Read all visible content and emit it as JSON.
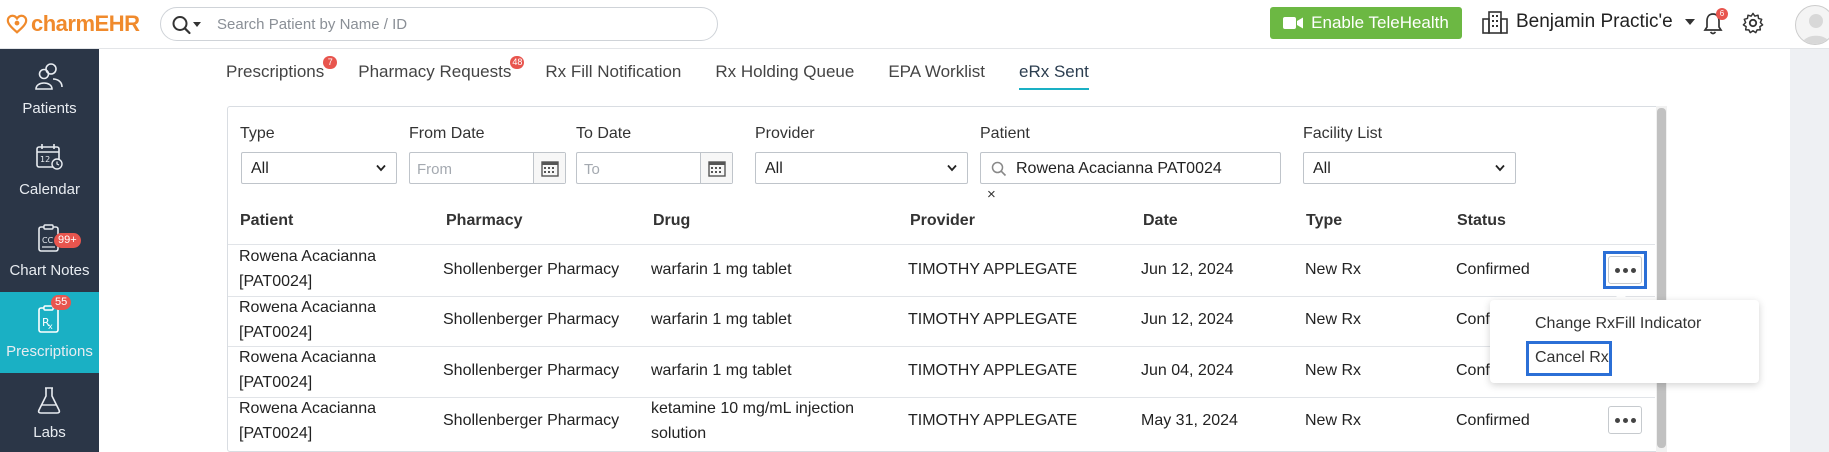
{
  "app": {
    "logo_left": "charm",
    "logo_right": "EHR"
  },
  "header": {
    "search_placeholder": "Search Patient by Name / ID",
    "telehealth_label": "Enable TeleHealth",
    "practice_name": "Benjamin Practic'e",
    "notification_count": "6"
  },
  "sidebar": {
    "items": [
      {
        "label": "Patients",
        "badge": "",
        "icon": "patients-icon"
      },
      {
        "label": "Calendar",
        "badge": "",
        "icon": "calendar-icon"
      },
      {
        "label": "Chart Notes",
        "badge": "99+",
        "icon": "chart-notes-icon"
      },
      {
        "label": "Prescriptions",
        "badge": "55",
        "icon": "rx-icon",
        "active": true
      },
      {
        "label": "Labs",
        "badge": "",
        "icon": "flask-icon"
      }
    ]
  },
  "tabs": [
    {
      "label": "Prescriptions",
      "badge": "7"
    },
    {
      "label": "Pharmacy Requests",
      "badge": "48"
    },
    {
      "label": "Rx Fill Notification",
      "badge": ""
    },
    {
      "label": "Rx Holding Queue",
      "badge": ""
    },
    {
      "label": "EPA Worklist",
      "badge": ""
    },
    {
      "label": "eRx Sent",
      "badge": "",
      "active": true
    }
  ],
  "filters": {
    "type_label": "Type",
    "type_value": "All",
    "from_label": "From Date",
    "from_placeholder": "From",
    "to_label": "To Date",
    "to_placeholder": "To",
    "provider_label": "Provider",
    "provider_value": "All",
    "patient_label": "Patient",
    "patient_value": "Rowena Acacianna PAT0024",
    "clear_symbol": "×",
    "facility_label": "Facility List",
    "facility_value": "All"
  },
  "table": {
    "headers": [
      "Patient",
      "Pharmacy",
      "Drug",
      "Provider",
      "Date",
      "Type",
      "Status"
    ],
    "rows": [
      {
        "patient_name": "Rowena Acacianna",
        "patient_id": "[PAT0024]",
        "pharmacy": "Shollenberger Pharmacy",
        "drug_l1": "warfarin 1 mg tablet",
        "drug_l2": "",
        "provider": "TIMOTHY APPLEGATE",
        "date": "Jun 12, 2024",
        "type": "New Rx",
        "status": "Confirmed"
      },
      {
        "patient_name": "Rowena Acacianna",
        "patient_id": "[PAT0024]",
        "pharmacy": "Shollenberger Pharmacy",
        "drug_l1": "warfarin 1 mg tablet",
        "drug_l2": "",
        "provider": "TIMOTHY APPLEGATE",
        "date": "Jun 12, 2024",
        "type": "New Rx",
        "status": "Confi"
      },
      {
        "patient_name": "Rowena Acacianna",
        "patient_id": "[PAT0024]",
        "pharmacy": "Shollenberger Pharmacy",
        "drug_l1": "warfarin 1 mg tablet",
        "drug_l2": "",
        "provider": "TIMOTHY APPLEGATE",
        "date": "Jun 04, 2024",
        "type": "New Rx",
        "status": "Confi"
      },
      {
        "patient_name": "Rowena Acacianna",
        "patient_id": "[PAT0024]",
        "pharmacy": "Shollenberger Pharmacy",
        "drug_l1": "ketamine 10 mg/mL injection",
        "drug_l2": "solution",
        "provider": "TIMOTHY APPLEGATE",
        "date": "May 31, 2024",
        "type": "New Rx",
        "status": "Confirmed"
      }
    ]
  },
  "context_menu": {
    "items": [
      "Change RxFill Indicator",
      "Cancel Rx"
    ]
  }
}
